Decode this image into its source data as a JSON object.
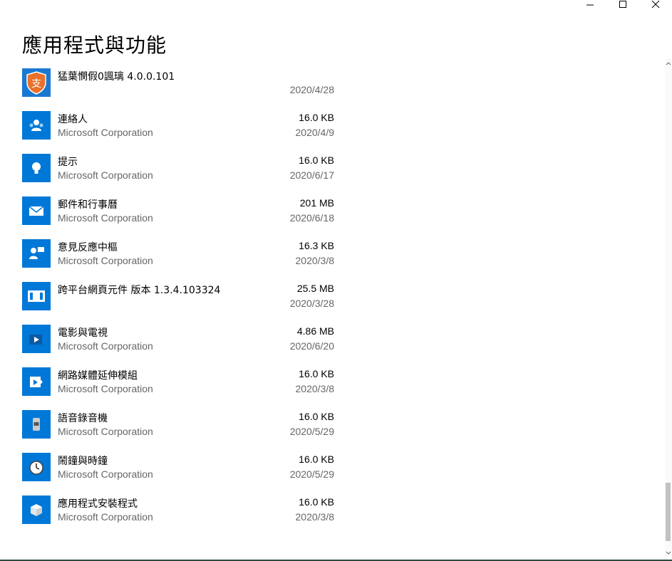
{
  "window": {
    "controls": {
      "minimize": "minimize-icon",
      "maximize": "maximize-icon",
      "close": "close-icon"
    }
  },
  "header": {
    "title": "應用程式與功能"
  },
  "apps": [
    {
      "name": "猛葉憫假0諷璃 4.0.0.101",
      "publisher": "",
      "size": "",
      "date": "2020/4/28",
      "icon": "alipay-icon",
      "icon_color": "#1a78d2"
    },
    {
      "name": "連絡人",
      "publisher": "Microsoft Corporation",
      "size": "16.0 KB",
      "date": "2020/4/9",
      "icon": "people-icon",
      "icon_color": "#0078d7"
    },
    {
      "name": "提示",
      "publisher": "Microsoft Corporation",
      "size": "16.0 KB",
      "date": "2020/6/17",
      "icon": "lightbulb-icon",
      "icon_color": "#0078d7"
    },
    {
      "name": "郵件和行事曆",
      "publisher": "Microsoft Corporation",
      "size": "201 MB",
      "date": "2020/6/18",
      "icon": "mail-icon",
      "icon_color": "#0078d7"
    },
    {
      "name": "意見反應中樞",
      "publisher": "Microsoft Corporation",
      "size": "16.3 KB",
      "date": "2020/3/8",
      "icon": "feedback-icon",
      "icon_color": "#0078d7"
    },
    {
      "name": "跨平台網頁元件 版本 1.3.4.103324",
      "publisher": "",
      "size": "25.5 MB",
      "date": "2020/3/28",
      "icon": "window-icon",
      "icon_color": "#0078d7"
    },
    {
      "name": "電影與電視",
      "publisher": "Microsoft Corporation",
      "size": "4.86 MB",
      "date": "2020/6/20",
      "icon": "movies-icon",
      "icon_color": "#0078d7"
    },
    {
      "name": "網路媒體延伸模組",
      "publisher": "Microsoft Corporation",
      "size": "16.0 KB",
      "date": "2020/3/8",
      "icon": "media-extension-icon",
      "icon_color": "#0078d7"
    },
    {
      "name": "語音錄音機",
      "publisher": "Microsoft Corporation",
      "size": "16.0 KB",
      "date": "2020/5/29",
      "icon": "voice-recorder-icon",
      "icon_color": "#0078d7"
    },
    {
      "name": "鬧鐘與時鐘",
      "publisher": "Microsoft Corporation",
      "size": "16.0 KB",
      "date": "2020/5/29",
      "icon": "clock-icon",
      "icon_color": "#0078d7"
    },
    {
      "name": "應用程式安裝程式",
      "publisher": "Microsoft Corporation",
      "size": "16.0 KB",
      "date": "2020/3/8",
      "icon": "app-installer-icon",
      "icon_color": "#0078d7"
    }
  ],
  "colors": {
    "accent": "#0078d7",
    "secondary_text": "#666666",
    "scrollbar_thumb": "#c2c2c2"
  },
  "scroll": {
    "position": 0.88
  }
}
